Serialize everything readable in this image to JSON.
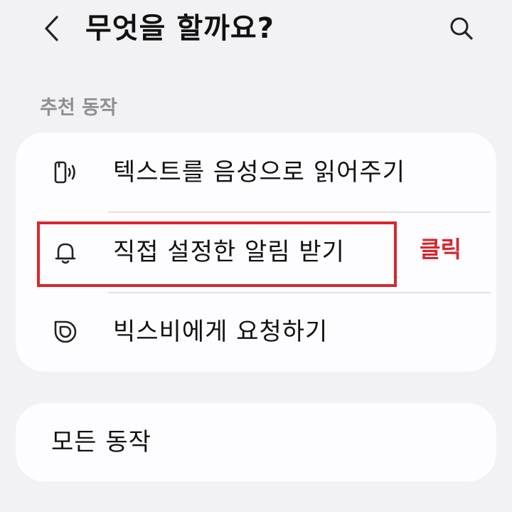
{
  "header": {
    "title": "무엇을 할까요?",
    "back_icon": "chevron-left-icon",
    "search_icon": "search-icon"
  },
  "section": {
    "label": "추천 동작"
  },
  "actions": [
    {
      "label": "텍스트를 음성으로 읽어주기",
      "icon": "phone-speaker-icon"
    },
    {
      "label": "직접 설정한 알림 받기",
      "icon": "bell-icon"
    },
    {
      "label": "빅스비에게 요청하기",
      "icon": "bixby-icon"
    }
  ],
  "annotation": {
    "click_note": "클릭",
    "color": "#d9262e"
  },
  "all_actions": {
    "label": "모든 동작"
  }
}
